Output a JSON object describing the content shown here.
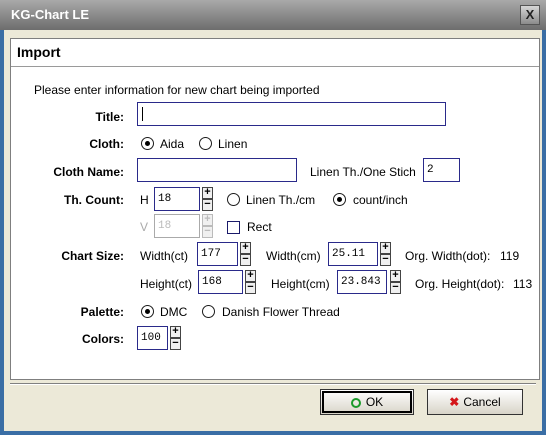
{
  "window": {
    "title": "KG-Chart LE",
    "close_glyph": "X"
  },
  "header": {
    "title": "Import"
  },
  "instruction": "Please enter information for new chart being imported",
  "title_field": {
    "label": "Title:",
    "value": ""
  },
  "cloth": {
    "label": "Cloth:",
    "options": [
      "Aida",
      "Linen"
    ],
    "selected": "Aida"
  },
  "cloth_name": {
    "label": "Cloth Name:",
    "value": "",
    "linen_label": "Linen Th./One Stich",
    "linen_value": "2"
  },
  "th_count": {
    "label": "Th. Count:",
    "h_label": "H",
    "h_value": "18",
    "v_label": "V",
    "v_value": "18",
    "unit_options": [
      "Linen Th./cm",
      "count/inch"
    ],
    "selected_unit": "count/inch",
    "rect_label": "Rect",
    "rect_checked": false
  },
  "chart_size": {
    "label": "Chart Size:",
    "width_ct_label": "Width(ct)",
    "width_ct": "177",
    "width_cm_label": "Width(cm)",
    "width_cm": "25.11",
    "org_width_label": "Org. Width(dot):",
    "org_width": "119",
    "height_ct_label": "Height(ct)",
    "height_ct": "168",
    "height_cm_label": "Height(cm)",
    "height_cm": "23.843",
    "org_height_label": "Org. Height(dot):",
    "org_height": "113"
  },
  "palette": {
    "label": "Palette:",
    "options": [
      "DMC",
      "Danish Flower Thread"
    ],
    "selected": "DMC"
  },
  "colors": {
    "label": "Colors:",
    "value": "100"
  },
  "buttons": {
    "ok": "OK",
    "cancel": "Cancel"
  },
  "spin_glyphs": {
    "up": "+",
    "down": "−"
  }
}
